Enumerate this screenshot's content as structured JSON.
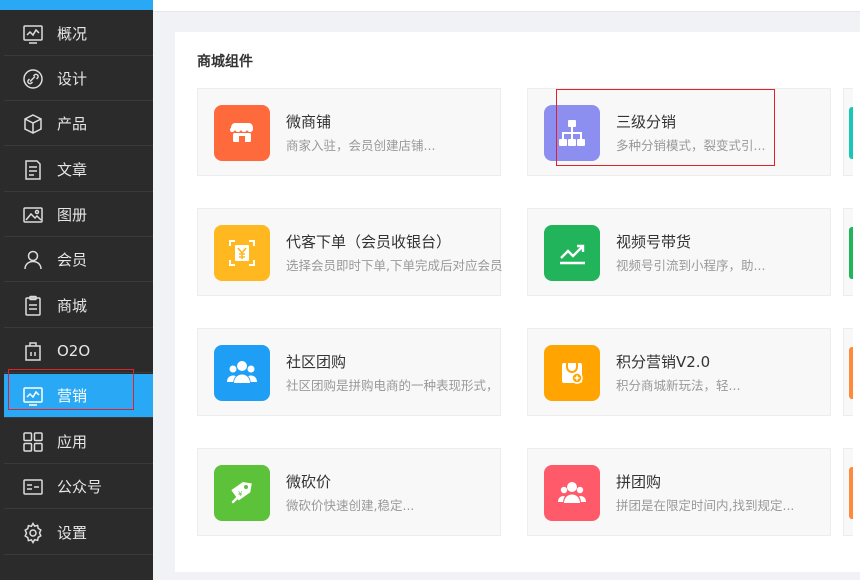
{
  "sidebar": {
    "items": [
      {
        "label": "概况",
        "icon": "chart-monitor-icon"
      },
      {
        "label": "设计",
        "icon": "link-circle-icon"
      },
      {
        "label": "产品",
        "icon": "box-icon"
      },
      {
        "label": "文章",
        "icon": "document-icon"
      },
      {
        "label": "图册",
        "icon": "image-icon"
      },
      {
        "label": "会员",
        "icon": "user-icon"
      },
      {
        "label": "商城",
        "icon": "clipboard-icon"
      },
      {
        "label": "O2O",
        "icon": "store-icon"
      },
      {
        "label": "营销",
        "icon": "chart-monitor-icon",
        "active": true
      },
      {
        "label": "应用",
        "icon": "grid-icon"
      },
      {
        "label": "公众号",
        "icon": "id-card-icon"
      },
      {
        "label": "设置",
        "icon": "gear-icon"
      }
    ]
  },
  "panel": {
    "title": "商城组件",
    "cards": [
      {
        "name": "微商铺",
        "desc": "商家入驻，会员创建店铺...",
        "icon": "storefront-icon",
        "color": "#ff6a3d"
      },
      {
        "name": "三级分销",
        "desc": "多种分销模式，裂变式引...",
        "icon": "org-chart-icon",
        "color": "#8c8ff0"
      },
      {
        "name": "代客下单（会员收银台）",
        "desc": "选择会员即时下单,下单完成后对应会员",
        "icon": "yen-scan-icon",
        "color": "#ffb81f"
      },
      {
        "name": "视频号带货",
        "desc": "视频号引流到小程序，助...",
        "icon": "trend-chart-icon",
        "color": "#22b45a"
      },
      {
        "name": "社区团购",
        "desc": "社区团购是拼购电商的一种表现形式，",
        "icon": "group-people-icon",
        "color": "#1e9ef5"
      },
      {
        "name": "积分营销V2.0",
        "desc": "积分商城新玩法，轻...",
        "icon": "points-bag-icon",
        "color": "#ffa400"
      },
      {
        "name": "微砍价",
        "desc": "微砍价快速创建,稳定...",
        "icon": "price-tag-icon",
        "color": "#5cc23a"
      },
      {
        "name": "拼团购",
        "desc": "拼团是在限定时间内,找到规定...",
        "icon": "group-buy-icon",
        "color": "#ff5a6a"
      }
    ],
    "edge_colors": [
      "#19c7b5",
      "#22b45a",
      "#ff8a3d",
      "#ff8a3d"
    ]
  }
}
